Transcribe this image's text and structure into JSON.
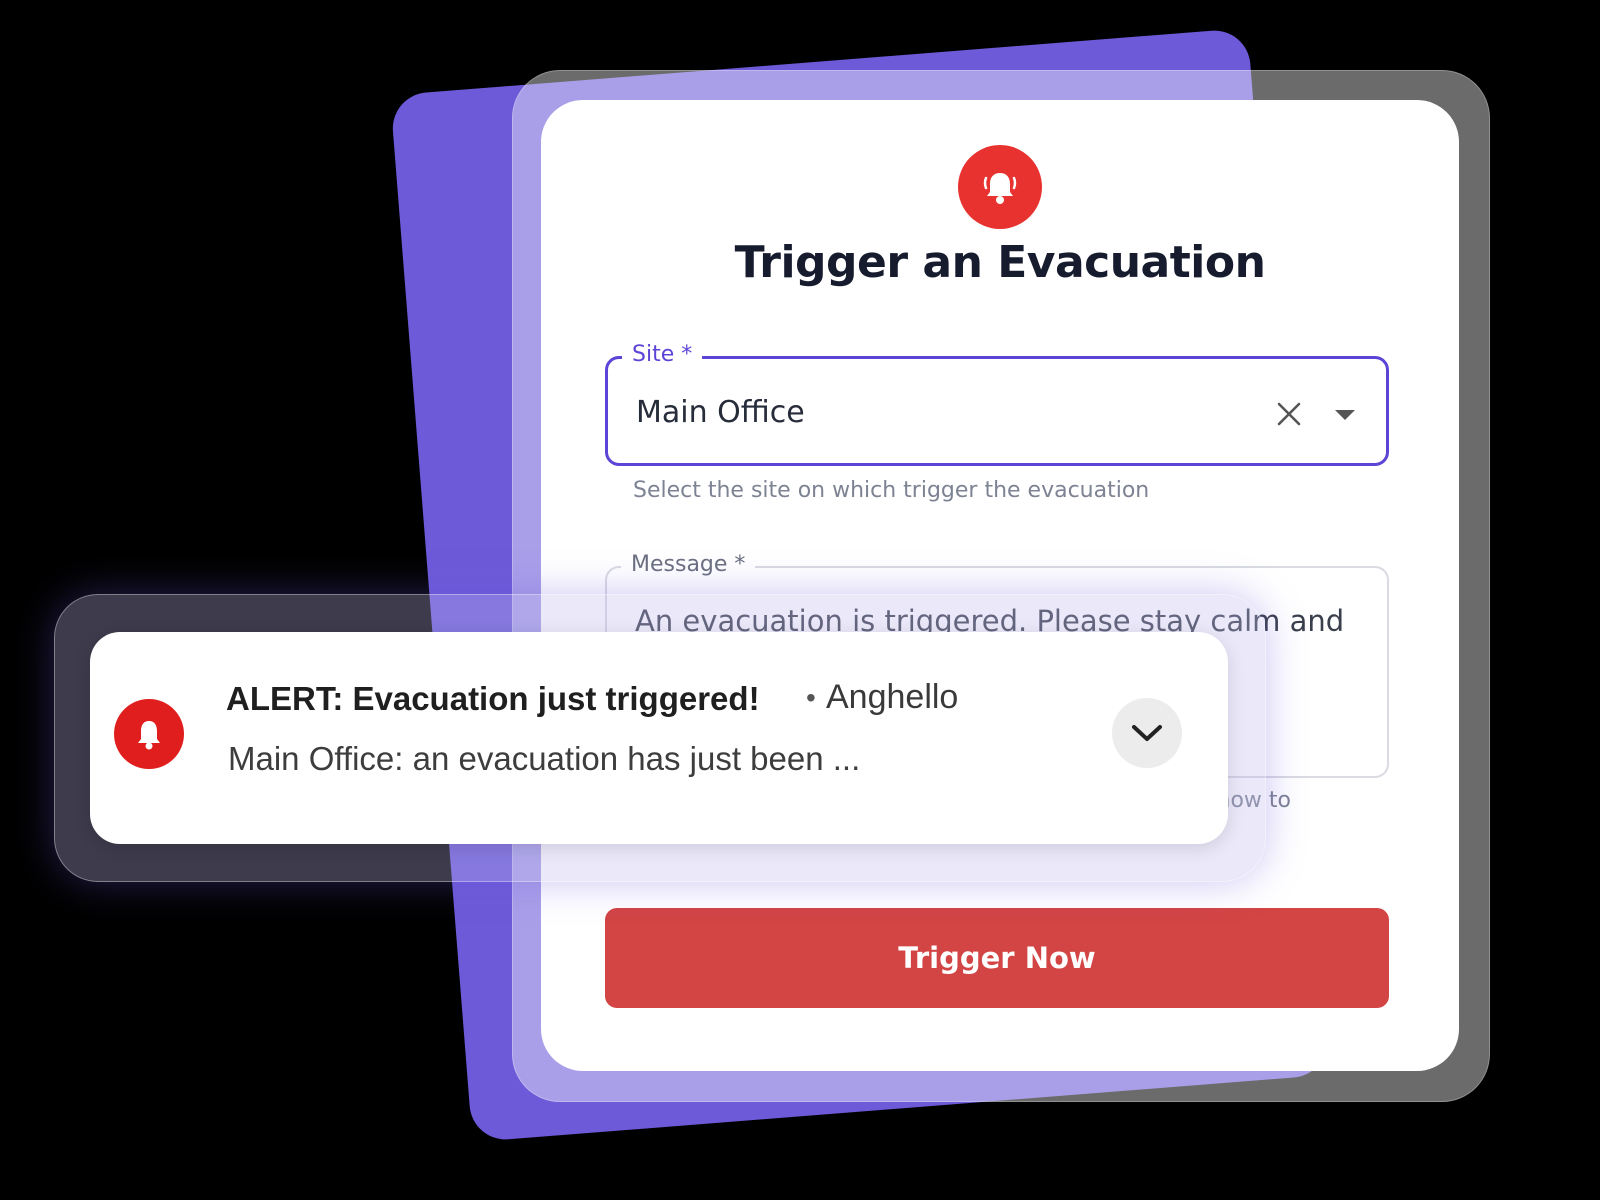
{
  "form": {
    "title": "Trigger an Evacuation",
    "site": {
      "label": "Site *",
      "value": "Main Office",
      "helper": "Select the site on which trigger the evacuation"
    },
    "message": {
      "label": "Message *",
      "value": "An evacuation is triggered. Please stay calm and",
      "helper": "how to"
    },
    "trigger_button": "Trigger Now"
  },
  "notification": {
    "title": "ALERT: Evacuation just triggered!",
    "separator": "•",
    "app_name": "Anghello",
    "body": "Main Office: an evacuation has just been ..."
  },
  "colors": {
    "background": "#000000",
    "backdrop_card": "#6c5ad9",
    "accent": "#5b45d6",
    "alert_red": "#e8322f",
    "button_red": "#d34444",
    "notification_red": "#e01e1e"
  },
  "icons": {
    "form_header": "bell-icon",
    "clear": "close-icon",
    "dropdown": "caret-down-icon",
    "notification": "bell-icon",
    "expand": "chevron-down-icon"
  }
}
